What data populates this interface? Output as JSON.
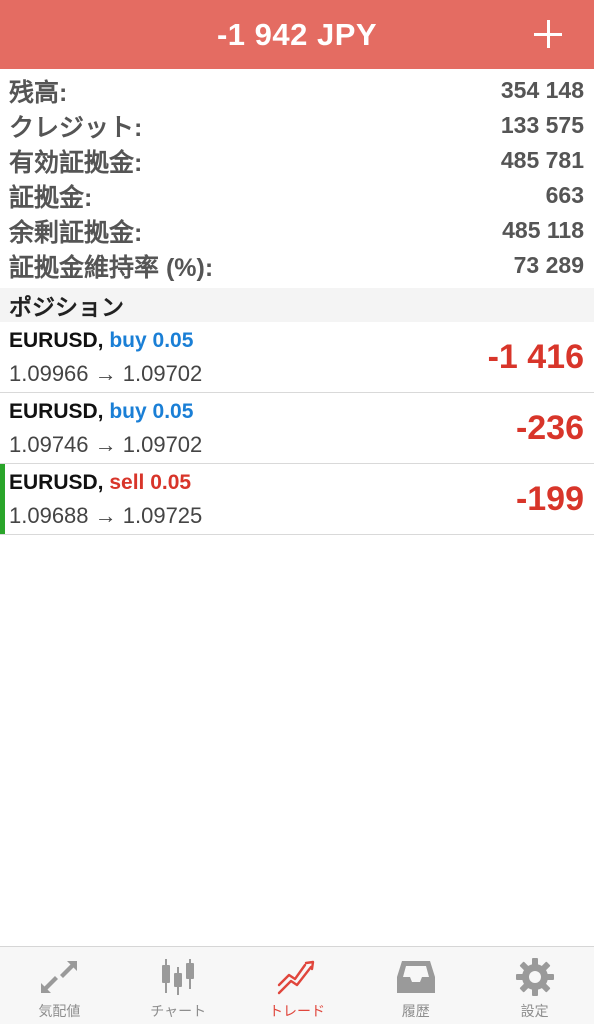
{
  "header": {
    "title": "-1 942 JPY",
    "add_icon": "plus-icon",
    "background": "#e46c62"
  },
  "summary": [
    {
      "label": "残高:",
      "value": "354 148"
    },
    {
      "label": "クレジット:",
      "value": "133 575"
    },
    {
      "label": "有効証拠金:",
      "value": "485 781"
    },
    {
      "label": "証拠金:",
      "value": "663"
    },
    {
      "label": "余剰証拠金:",
      "value": "485 118"
    },
    {
      "label": "証拠金維持率 (%):",
      "value": "73 289"
    }
  ],
  "positions_section": {
    "title": "ポジション"
  },
  "positions": [
    {
      "symbol": "EURUSD,",
      "type": "buy 0.05",
      "prices": "1.09966 → 1.09702",
      "profit": "-1 416",
      "selected": false
    },
    {
      "symbol": "EURUSD,",
      "type": "buy 0.05",
      "prices": "1.09746 → 1.09702",
      "profit": "-236",
      "selected": false
    },
    {
      "symbol": "EURUSD,",
      "type": "sell 0.05",
      "prices": "1.09688 → 1.09725",
      "profit": "-199",
      "selected": true
    }
  ],
  "colors": {
    "buy": "#1a7fd6",
    "sell": "#d8352a",
    "loss": "#d8352a",
    "selected_indicator": "#2aa52a",
    "active_tab": "#e0463c"
  },
  "tabs": [
    {
      "label": "気配値",
      "icon": "quotes-icon",
      "active": false
    },
    {
      "label": "チャート",
      "icon": "chart-icon",
      "active": false
    },
    {
      "label": "トレード",
      "icon": "trade-icon",
      "active": true
    },
    {
      "label": "履歴",
      "icon": "history-icon",
      "active": false
    },
    {
      "label": "設定",
      "icon": "settings-icon",
      "active": false
    }
  ]
}
